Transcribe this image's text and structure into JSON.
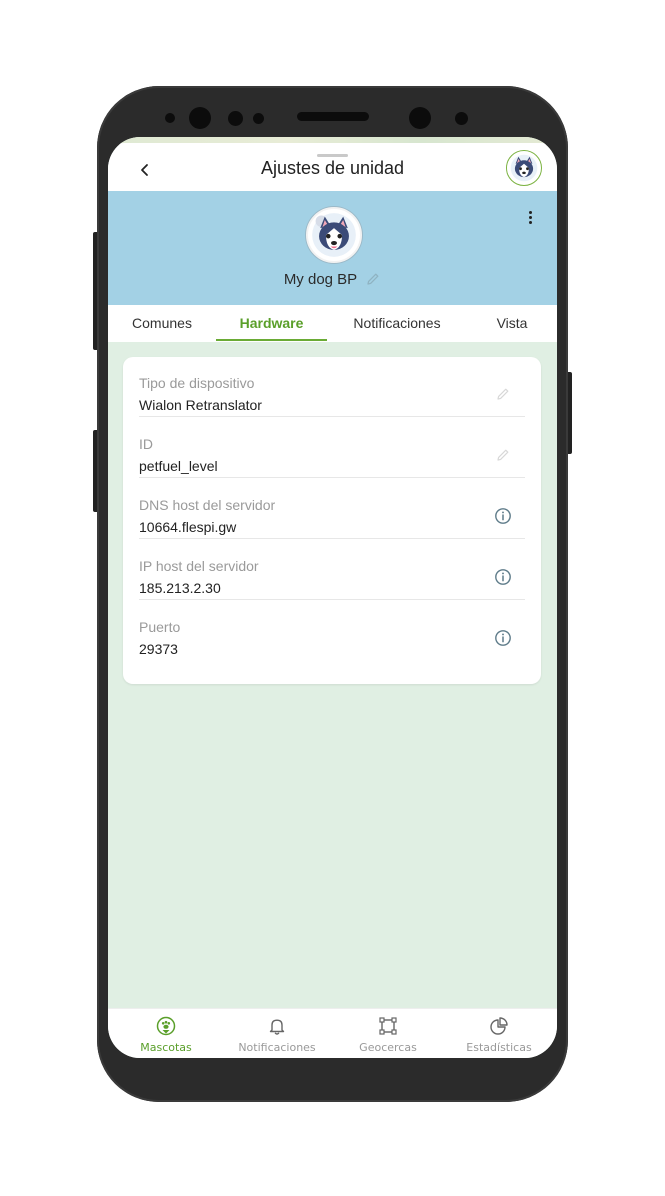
{
  "header": {
    "title": "Ajustes de unidad",
    "back_icon": "chevron-left-icon",
    "avatar_icon": "husky-avatar-icon"
  },
  "profile": {
    "unit_name": "My dog BP",
    "avatar_icon": "husky-avatar-icon",
    "edit_icon": "pencil-icon",
    "more_icon": "more-vertical-icon",
    "background_color": "#a3d1e5"
  },
  "tabs": [
    {
      "label": "Comunes",
      "active": false
    },
    {
      "label": "Hardware",
      "active": true
    },
    {
      "label": "Notificaciones",
      "active": false
    },
    {
      "label": "Vista",
      "active": false
    }
  ],
  "hardware": {
    "fields": [
      {
        "label": "Tipo de dispositivo",
        "value": "Wialon Retranslator",
        "icon": "pencil-icon"
      },
      {
        "label": "ID",
        "value": "petfuel_level",
        "icon": "pencil-icon"
      },
      {
        "label": "DNS host del servidor",
        "value": "10664.flespi.gw",
        "icon": "info-icon"
      },
      {
        "label": "IP host del servidor",
        "value": "185.213.2.30",
        "icon": "info-icon"
      },
      {
        "label": "Puerto",
        "value": "29373",
        "icon": "info-icon"
      }
    ]
  },
  "bottom_nav": [
    {
      "label": "Mascotas",
      "icon": "paw-icon",
      "active": true
    },
    {
      "label": "Notificaciones",
      "icon": "bell-icon",
      "active": false
    },
    {
      "label": "Geocercas",
      "icon": "geofence-icon",
      "active": false
    },
    {
      "label": "Estadísticas",
      "icon": "pie-chart-icon",
      "active": false
    }
  ],
  "colors": {
    "accent": "#5a9f2a",
    "screen_background": "#e0efe3"
  }
}
